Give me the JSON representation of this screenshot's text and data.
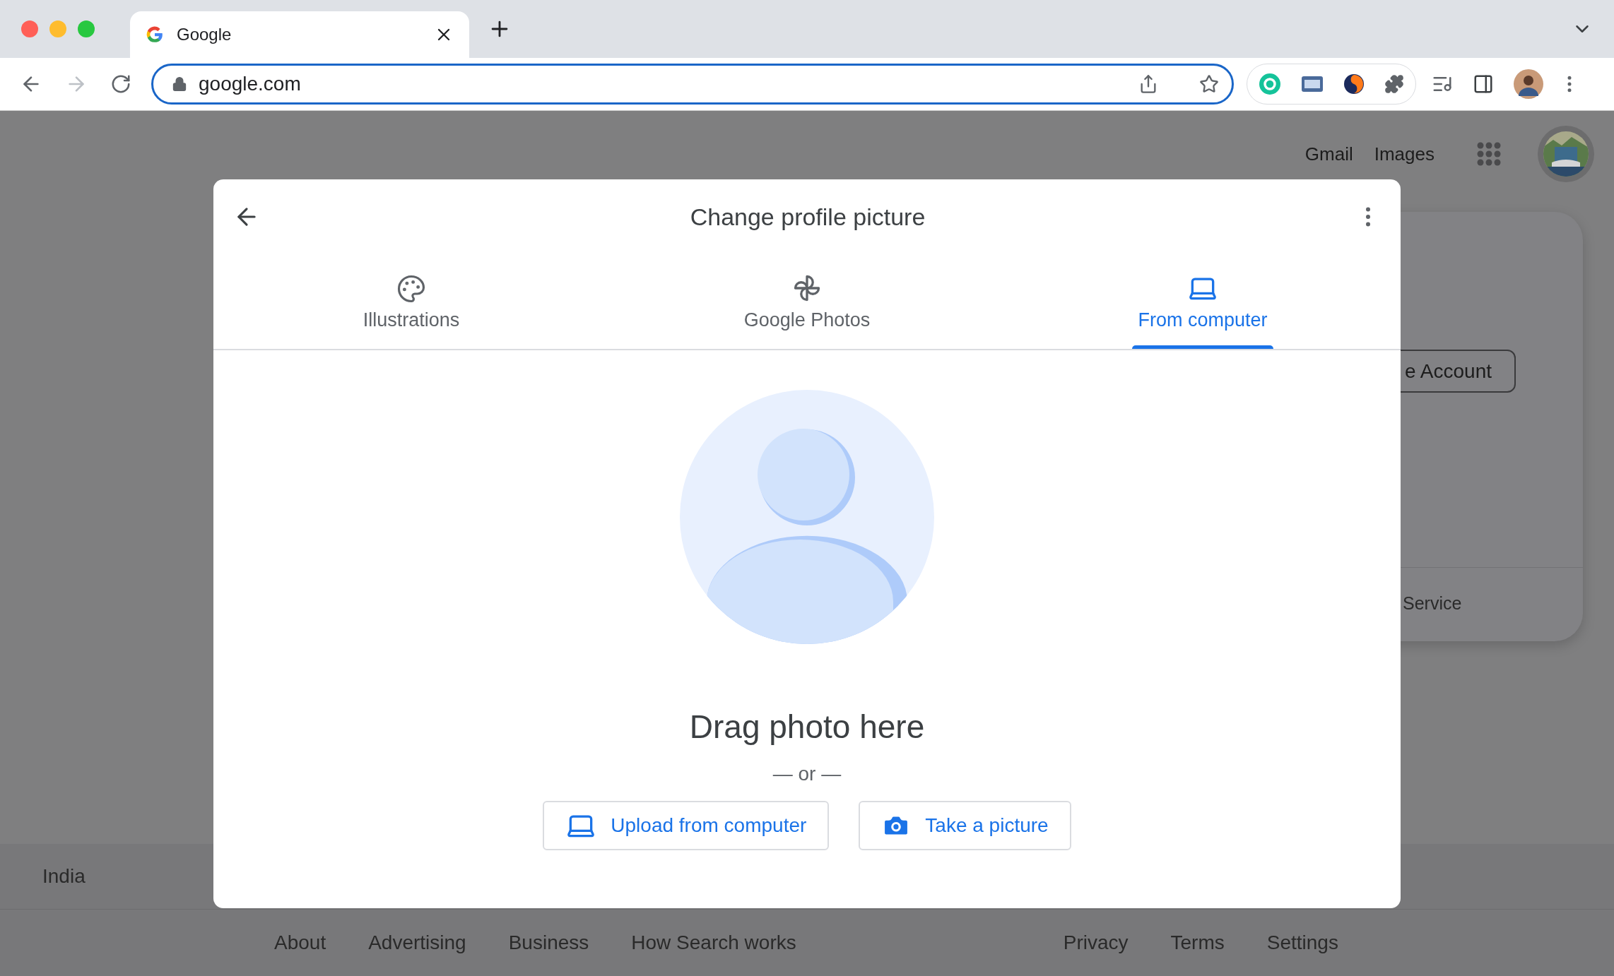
{
  "browser": {
    "tab": {
      "title": "Google"
    },
    "address": "google.com"
  },
  "page": {
    "header_links": [
      "Gmail",
      "Images"
    ],
    "card": {
      "button": "e Account",
      "link": "Service"
    },
    "footer": {
      "country": "India",
      "links_left": [
        "About",
        "Advertising",
        "Business",
        "How Search works"
      ],
      "links_right": [
        "Privacy",
        "Terms",
        "Settings"
      ]
    }
  },
  "dialog": {
    "title": "Change profile picture",
    "tabs": [
      {
        "label": "Illustrations",
        "selected": false
      },
      {
        "label": "Google Photos",
        "selected": false
      },
      {
        "label": "From computer",
        "selected": true
      }
    ],
    "drop_text": "Drag photo here",
    "separator": "— or —",
    "buttons": [
      "Upload from computer",
      "Take a picture"
    ]
  }
}
